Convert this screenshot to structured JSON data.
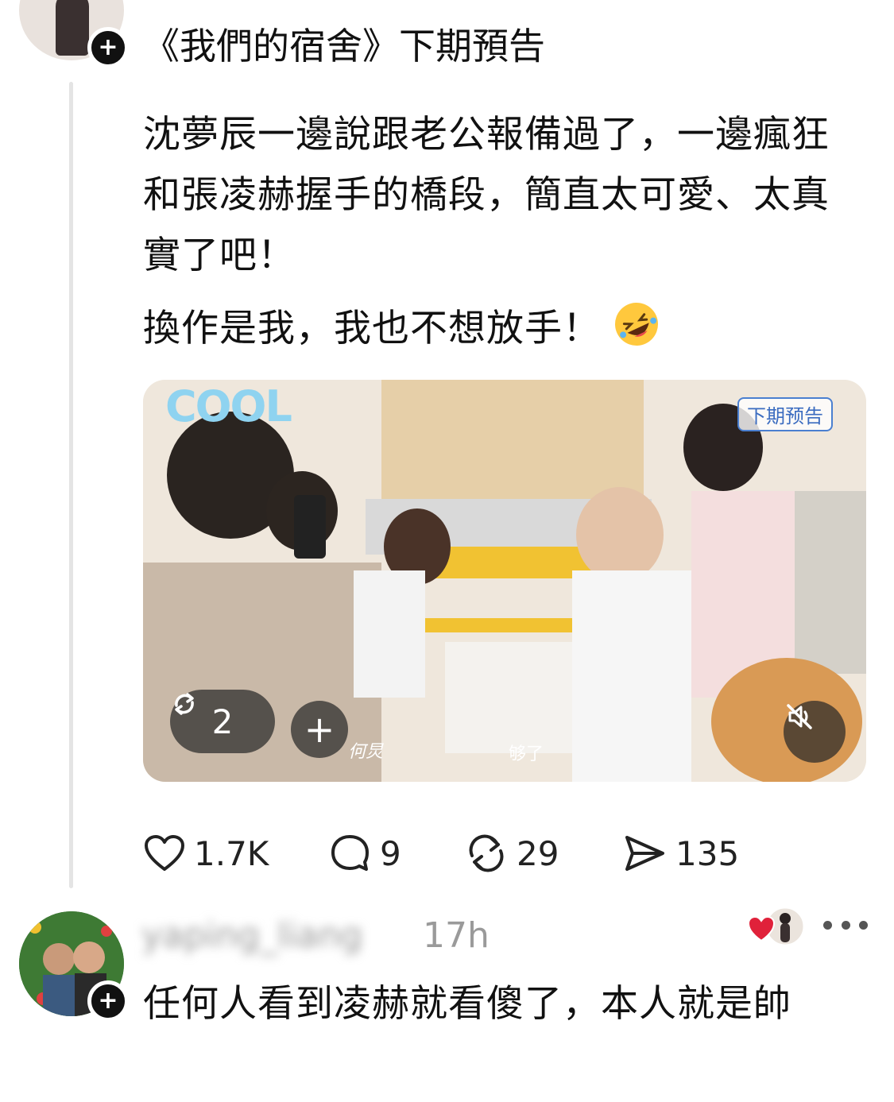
{
  "post": {
    "title": "《我們的宿舍》下期預告",
    "body_paragraphs": [
      "沈夢辰一邊說跟老公報備過了，一邊瘋狂和張凌赫握手的橋段，簡直太可愛、太真實了吧！",
      "換作是我，我也不想放手！"
    ],
    "emoji": "rolling-on-floor-laughing-emoji",
    "media": {
      "sticker_text": "COOL",
      "overlay_tag": "下期预告",
      "subtitle_name": "何炅",
      "subtitle_text": "够了",
      "carousel_count": "2",
      "add_symbol": "+",
      "muted": true
    },
    "stats": {
      "likes": "1.7K",
      "replies": "9",
      "reposts": "29",
      "shares": "135"
    }
  },
  "reply": {
    "username": "yaping_liang",
    "time": "17h",
    "text": "任何人看到凌赫就看傻了，本人就是帥"
  },
  "follow_symbol": "+",
  "colors": {
    "text": "#111111",
    "muted_text": "#9a9a9a",
    "heart": "#e0213a",
    "thread_line": "#e4e4e4"
  }
}
